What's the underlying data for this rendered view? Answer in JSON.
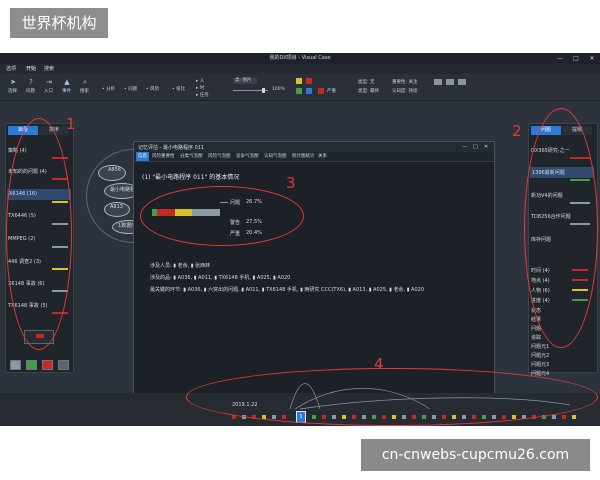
{
  "watermarks": {
    "top_left": "世界杯机构",
    "bottom_right": "cn-cnwebs-cupcmu26.com"
  },
  "window": {
    "title": "我的DX项目 - Visual Case",
    "menu": [
      "选项",
      "开始",
      "搜索"
    ],
    "controls": [
      "—",
      "□",
      "✕"
    ]
  },
  "ribbon": {
    "big_buttons": [
      {
        "label": "选择",
        "icon": "cursor-icon"
      },
      {
        "label": "问题",
        "icon": "question-icon"
      },
      {
        "label": "入口",
        "icon": "entry-icon"
      },
      {
        "label": "事件",
        "icon": "event-icon"
      },
      {
        "label": "搜索",
        "icon": "search-icon"
      }
    ],
    "row1": [
      "• 分析",
      "• 问题",
      "• 风险",
      "• 排比"
    ],
    "row2": [
      "▸ 人",
      "▸ 时",
      "▸ 任务"
    ],
    "zoom": "100%",
    "severity": "严重",
    "filter1": "类型: 无",
    "filter2": "重要性: 关注",
    "filter3": "类型: 最终",
    "filter4": "认知度: 持续",
    "view_label": "类: 图片"
  },
  "left_panel": {
    "tabs": [
      "目录",
      "排序"
    ],
    "items": [
      {
        "label": "策略 (4)",
        "color": "#c62828"
      },
      {
        "label": "未知的的问题 (4)",
        "color": "#c62828"
      },
      {
        "label": "X6148 (16)",
        "color": "#d8c22c"
      },
      {
        "label": "TX6446 (5)",
        "color": "#8c9aa8"
      },
      {
        "label": "MMPEG (2)",
        "color": "#8c9aa8"
      },
      {
        "label": "446 调查2 (3)",
        "color": "#d8c22c"
      },
      {
        "label": "X6148 事故 (6)",
        "color": "#8c9aa8"
      },
      {
        "label": "TX6148 事故 (5)",
        "color": "#c62828"
      }
    ]
  },
  "right_panel": {
    "tabs": [
      "问题",
      "提纲"
    ],
    "items": [
      {
        "label": "DX365研究-之一",
        "color": "#c62828"
      },
      {
        "label": "1396最新问题",
        "color": "#43a047"
      },
      {
        "label": "新功V4的问题",
        "color": "#8c9aa8"
      },
      {
        "label": "TD8256合作问题",
        "color": "#8c9aa8"
      },
      {
        "label": "库存问题",
        "color": "#8c9aa8"
      }
    ],
    "sub_items": [
      "时间 (4)",
      "地点 (4)",
      "人物 (6)",
      "进度 (4)",
      "状态",
      "结果",
      "问题",
      "追踪",
      "问题元1",
      "问题元2",
      "问题元3",
      "问题元4"
    ]
  },
  "nodes": [
    {
      "label": "A856"
    },
    {
      "label": "最小电路程"
    },
    {
      "label": "A813"
    },
    {
      "label": "1数据库"
    }
  ],
  "dialog": {
    "title": "记忆评估 - 最小电路程序 011",
    "tabs": [
      "信息",
      "风险重要性",
      "分类气泡图",
      "风险气泡图",
      "竞争气泡图",
      "认知气泡图",
      "统计图统计",
      "关系"
    ],
    "heading": "(1) \"最小电路程序 011\" 的基本情况",
    "legend": [
      {
        "label": "问题",
        "value": "26.7%"
      },
      {
        "label": "警告",
        "value": "27.5%"
      },
      {
        "label": "严重",
        "value": "20.4%"
      }
    ],
    "segments": [
      {
        "color": "#43a047",
        "share": 8
      },
      {
        "color": "#c62828",
        "share": 27
      },
      {
        "color": "#d8c22c",
        "share": 25
      },
      {
        "color": "#8c9aa8",
        "share": 40
      }
    ],
    "line1": "涉及人员: ▮ 老余, ▮ 张西林",
    "line2": "涉及的品: ▮ A036, ▮ A011, ▮ TX6148 手机, ▮ A025, ▮ A020",
    "line3": "最关键的环节: ▮ A036, ▮ 六突出的问题, ▮ A011, ▮ TX6148 手机, ▮ 两研究 CCC(TX6), ▮ A013, ▮ A025, ▮ 老余, ▮ A020"
  },
  "timeline": {
    "label": "2019.1.22",
    "marker": "1"
  },
  "annotations": [
    "1",
    "2",
    "3",
    "4"
  ]
}
